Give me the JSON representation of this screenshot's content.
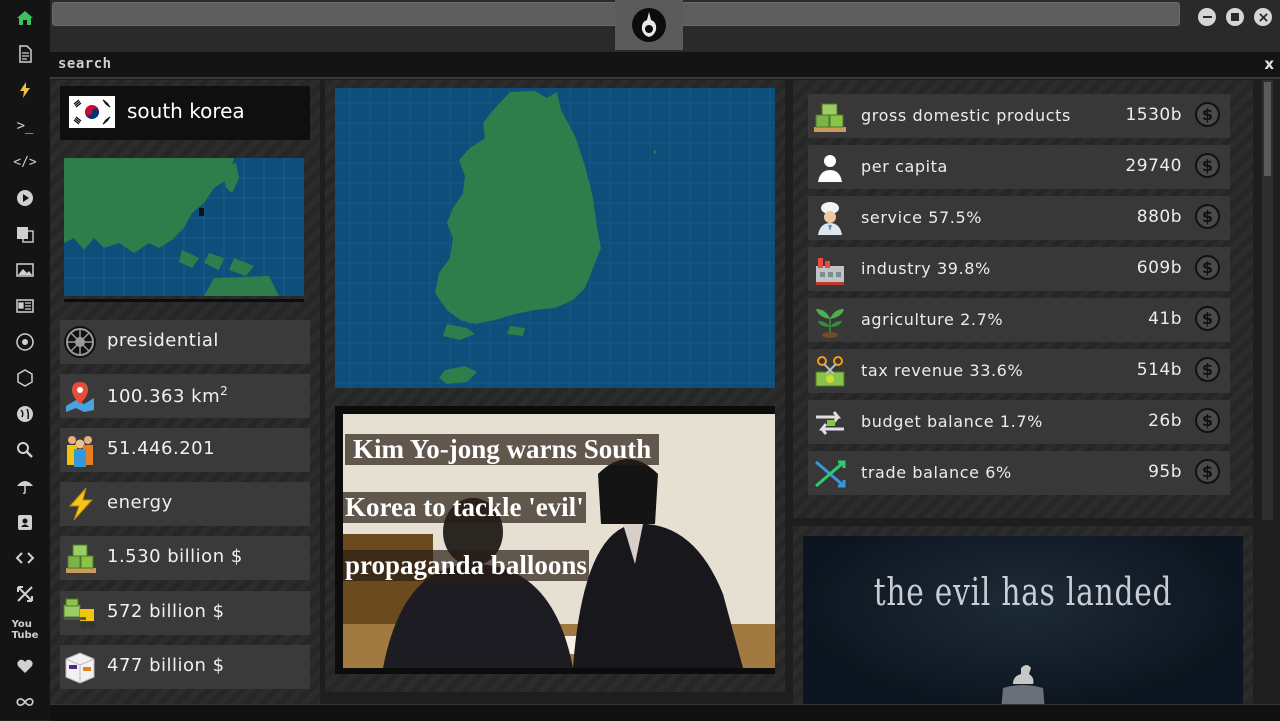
{
  "search": {
    "label": "search",
    "close": "x"
  },
  "country": {
    "name": "south korea"
  },
  "left_stats": [
    {
      "icon": "empire-icon",
      "text": "presidential"
    },
    {
      "icon": "map-pin-icon",
      "text": "100.363 km",
      "sup": "2"
    },
    {
      "icon": "population-icon",
      "text": "51.446.201"
    },
    {
      "icon": "lightning-icon",
      "text": "energy"
    },
    {
      "icon": "money-pallet-icon",
      "text": "1.530 billion $"
    },
    {
      "icon": "forklift-money-icon",
      "text": "572 billion $"
    },
    {
      "icon": "box-icon",
      "text": "477 billion $"
    }
  ],
  "news": {
    "headline_lines": [
      "Kim Yo-jong warns South",
      "Korea to tackle 'evil'",
      "propaganda balloons"
    ]
  },
  "stats": [
    {
      "icon": "money-pallet-icon",
      "label": "gross domestic products",
      "value": "1530b"
    },
    {
      "icon": "person-icon",
      "label": "per capita",
      "value": "29740"
    },
    {
      "icon": "chef-icon",
      "label": "service 57.5%",
      "value": "880b"
    },
    {
      "icon": "factory-icon",
      "label": "industry 39.8%",
      "value": "609b"
    },
    {
      "icon": "sprout-icon",
      "label": "agriculture 2.7%",
      "value": "41b"
    },
    {
      "icon": "scissors-money-icon",
      "label": "tax revenue 33.6%",
      "value": "514b"
    },
    {
      "icon": "arrows-exchange-icon",
      "label": "budget balance 1.7%",
      "value": "26b"
    },
    {
      "icon": "trade-cross-icon",
      "label": "trade balance 6%",
      "value": "95b"
    }
  ],
  "coin_symbol": "$",
  "promo": {
    "text": "the evil has landed"
  },
  "colors": {
    "map_sea": "#0d4f7a",
    "map_land": "#2f7d4a",
    "rail_bg": "#141414"
  }
}
